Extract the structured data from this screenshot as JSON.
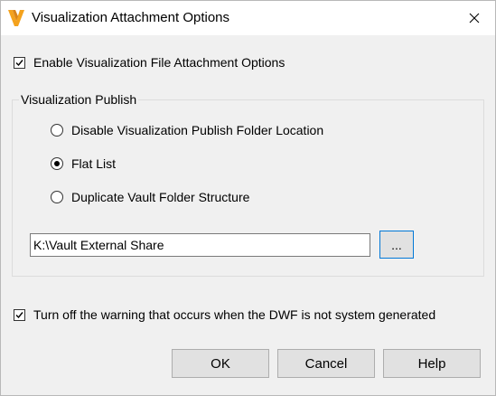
{
  "window": {
    "title": "Visualization Attachment Options",
    "icon": "vault-v-icon",
    "accent_color": "#f4a21d",
    "focus_color": "#0078d7"
  },
  "enable_option": {
    "label": "Enable Visualization File Attachment Options",
    "checked": true
  },
  "visualization_publish": {
    "legend": "Visualization Publish",
    "options": [
      {
        "label": "Disable Visualization Publish Folder Location",
        "selected": false
      },
      {
        "label": "Flat List",
        "selected": true
      },
      {
        "label": "Duplicate Vault Folder Structure",
        "selected": false
      }
    ],
    "folder_path": "K:\\Vault External Share",
    "browse_label": "..."
  },
  "warning_option": {
    "label": "Turn off the warning that occurs when the DWF is not system generated",
    "checked": true
  },
  "buttons": {
    "ok": "OK",
    "cancel": "Cancel",
    "help": "Help"
  }
}
